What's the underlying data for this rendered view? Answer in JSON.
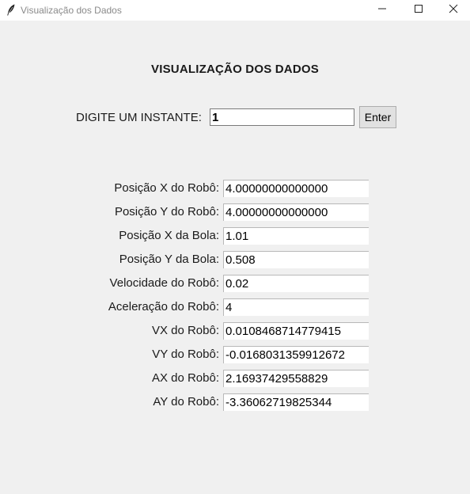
{
  "window": {
    "title": "Visualização dos Dados",
    "minimize_icon": "minimize-icon",
    "maximize_icon": "maximize-icon",
    "close_icon": "close-icon",
    "app_icon": "feather-icon"
  },
  "main": {
    "heading": "VISUALIZAÇÃO DOS DADOS",
    "instant_label": "DIGITE UM INSTANTE:",
    "instant_value": "1",
    "enter_label": "Enter"
  },
  "fields": [
    {
      "label": "Posição X do Robô:",
      "value": "4.00000000000000"
    },
    {
      "label": "Posição Y do Robô:",
      "value": "4.00000000000000"
    },
    {
      "label": "Posição X da Bola:",
      "value": "1.01"
    },
    {
      "label": "Posição Y da Bola:",
      "value": "0.508"
    },
    {
      "label": "Velocidade do Robô:",
      "value": "0.02"
    },
    {
      "label": "Aceleração do Robô:",
      "value": "4"
    },
    {
      "label": "VX do Robô:",
      "value": "0.0108468714779415"
    },
    {
      "label": "VY do Robô:",
      "value": "-0.0168031359912672"
    },
    {
      "label": "AX do Robô:",
      "value": "2.16937429558829"
    },
    {
      "label": "AY do Robô:",
      "value": "-3.36062719825344"
    }
  ]
}
